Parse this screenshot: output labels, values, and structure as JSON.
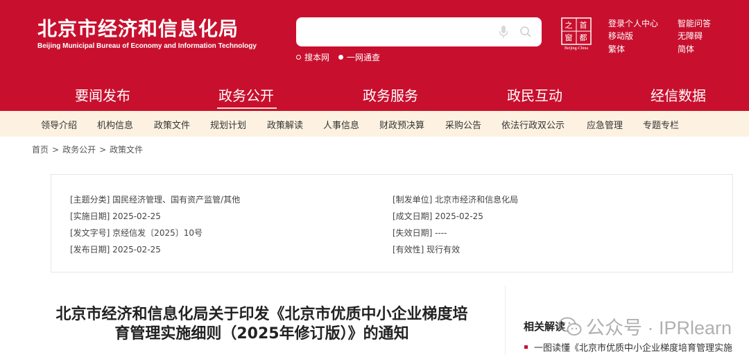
{
  "site": {
    "name_cn": "北京市经济和信息化局",
    "name_en": "Beijing Municipal Bureau of Economy and Information Technology",
    "seal_text": "Beijing-China"
  },
  "search": {
    "placeholder": "",
    "scope_options": [
      "搜本网",
      "一网通查"
    ],
    "scope_selected": "一网通查"
  },
  "toplinks": {
    "login": "登录个人中心",
    "mobile": "移动版",
    "traditional": "繁体",
    "qa": "智能问答",
    "accessible": "无障碍",
    "simplified": "简体"
  },
  "mainnav": {
    "items": [
      "要闻发布",
      "政务公开",
      "政务服务",
      "政民互动",
      "经信数据"
    ],
    "active": "政务公开"
  },
  "subnav": {
    "items": [
      "领导介绍",
      "机构信息",
      "政策文件",
      "规划计划",
      "政策解读",
      "人事信息",
      "财政预决算",
      "采购公告",
      "依法行政双公示",
      "应急管理",
      "专题专栏"
    ]
  },
  "breadcrumb": [
    "首页",
    "政务公开",
    "政策文件"
  ],
  "meta": {
    "topic": "[主题分类] 国民经济管理、国有资产监管/其他",
    "implement_date": "[实施日期] 2025-02-25",
    "doc_number": "[发文字号] 京经信发〔2025〕10号",
    "publish_date": "[发布日期] 2025-02-25",
    "issuer": "[制发单位] 北京市经济和信息化局",
    "written_date": "[成文日期] 2025-02-25",
    "expire_date": "[失效日期] ----",
    "validity": "[有效性] 现行有效"
  },
  "document": {
    "title_line1": "北京市经济和信息化局关于印发《北京市优质中小企业梯度培",
    "title_line2": "育管理实施细则（2025年修订版）》的通知"
  },
  "related": {
    "heading": "相关解读",
    "items": [
      "一图读懂《北京市优质中小企业梯度培育管理实施"
    ]
  },
  "watermark": "公众号 · IPRlearn",
  "colors": {
    "brand_red": "#c8102e",
    "subnav_bg": "#fdf2e1"
  }
}
